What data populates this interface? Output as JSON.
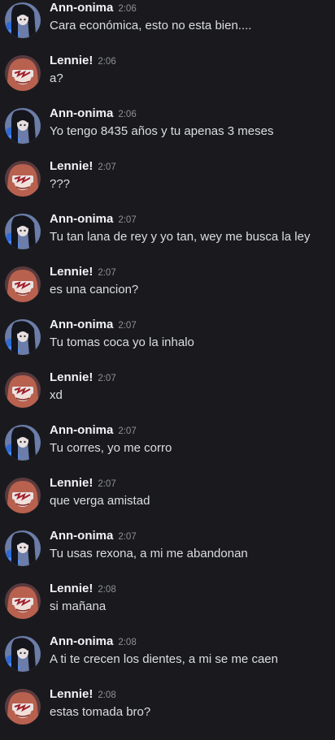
{
  "messages": [
    {
      "author": "Ann-onima",
      "time": "2:06",
      "text": "Cara económica, esto no esta bien...."
    },
    {
      "author": "Lennie!",
      "time": "2:06",
      "text": "a?"
    },
    {
      "author": "Ann-onima",
      "time": "2:06",
      "text": "Yo tengo 8435 años y tu apenas 3 meses"
    },
    {
      "author": "Lennie!",
      "time": "2:07",
      "text": "???"
    },
    {
      "author": "Ann-onima",
      "time": "2:07",
      "text": "Tu tan lana de rey y yo tan, wey me busca la ley"
    },
    {
      "author": "Lennie!",
      "time": "2:07",
      "text": "es una cancion?"
    },
    {
      "author": "Ann-onima",
      "time": "2:07",
      "text": "Tu tomas coca yo la inhalo"
    },
    {
      "author": "Lennie!",
      "time": "2:07",
      "text": "xd"
    },
    {
      "author": "Ann-onima",
      "time": "2:07",
      "text": "Tu corres, yo me corro"
    },
    {
      "author": "Lennie!",
      "time": "2:07",
      "text": "que verga amistad"
    },
    {
      "author": "Ann-onima",
      "time": "2:07",
      "text": "Tu usas rexona, a mi me abandonan"
    },
    {
      "author": "Lennie!",
      "time": "2:08",
      "text": "si mañana"
    },
    {
      "author": "Ann-onima",
      "time": "2:08",
      "text": "A ti te crecen los dientes, a mi se me caen"
    },
    {
      "author": "Lennie!",
      "time": "2:08",
      "text": "estas tomada bro?"
    }
  ]
}
